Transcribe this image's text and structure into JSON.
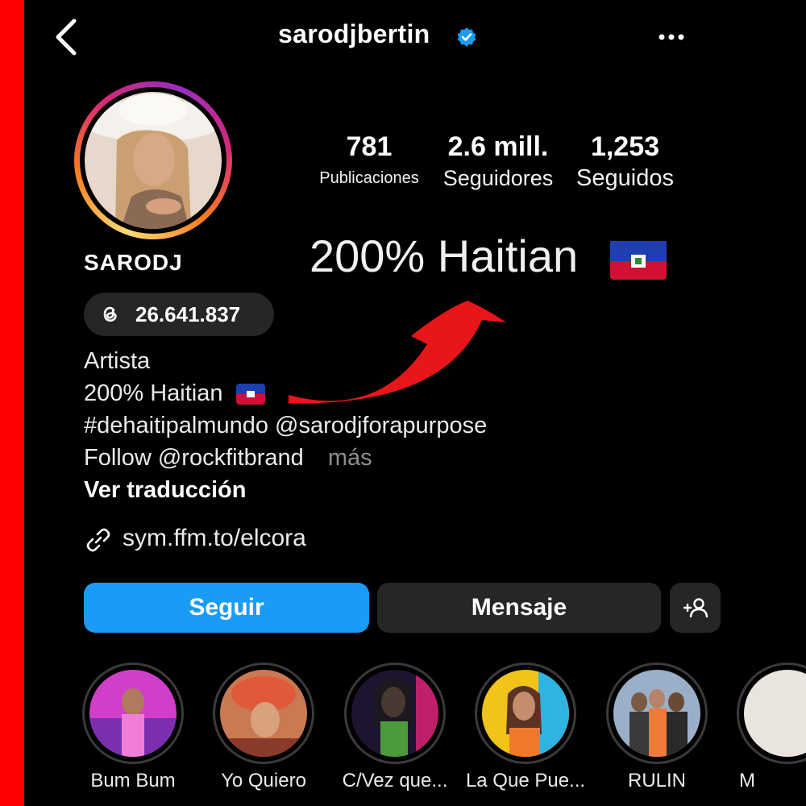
{
  "header": {
    "username": "sarodjbertin",
    "icons": {
      "back": "chevron-left-icon",
      "verified": "verified-badge-icon",
      "more": "more-horizontal-icon"
    }
  },
  "stats": [
    {
      "value": "781",
      "label": "Publicaciones"
    },
    {
      "value": "2.6 mill.",
      "label": "Seguidores"
    },
    {
      "value": "1,253",
      "label": "Seguidos"
    }
  ],
  "overlay": {
    "bio_highlight": "200% Haitian"
  },
  "profile": {
    "display_name": "SARODJ",
    "threads_count": "26.641.837",
    "bio": {
      "category": "Artista",
      "line1": "200% Haitian",
      "line2": "#dehaitipalmundo @sarodjforapurpose",
      "line3": "Follow @rockfitbrand",
      "more": "más"
    },
    "translate": "Ver traducción",
    "link": "sym.ffm.to/elcora"
  },
  "actions": {
    "follow": "Seguir",
    "message": "Mensaje"
  },
  "highlights": [
    {
      "label": "Bum Bum"
    },
    {
      "label": "Yo Quiero"
    },
    {
      "label": "C/Vez que..."
    },
    {
      "label": "La Que Pue..."
    },
    {
      "label": "RULIN"
    },
    {
      "label": "M"
    }
  ],
  "colors": {
    "accent": "#1a9bf5",
    "background": "#000000",
    "side_bar": "#ff0000",
    "arrow": "#e8151b",
    "verified": "#1a9bf5"
  }
}
